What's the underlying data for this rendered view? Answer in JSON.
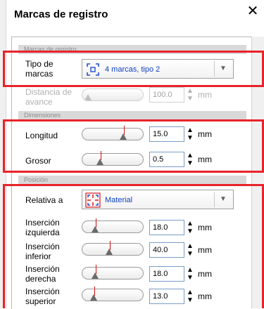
{
  "dialog": {
    "title": "Marcas de registro",
    "close": "✕"
  },
  "sections": {
    "marks_header": "Marcas de registro",
    "dimensions_header": "Dimensiones",
    "position_header": "Posición"
  },
  "marks": {
    "type_label": "Tipo de marcas",
    "type_value": "4 marcas, tipo 2",
    "advance_label": "Distancia de avance",
    "advance_value": "100.0",
    "advance_unit": "mm"
  },
  "dimensions": {
    "length_label": "Longitud",
    "length_value": "15.0",
    "length_unit": "mm",
    "thickness_label": "Grosor",
    "thickness_value": "0.5",
    "thickness_unit": "mm"
  },
  "position": {
    "relative_label": "Relativa a",
    "relative_value": "Material",
    "insets": [
      {
        "label": "Inserción izquierda",
        "value": "18.0",
        "unit": "mm"
      },
      {
        "label": "Inserción inferior",
        "value": "40.0",
        "unit": "mm"
      },
      {
        "label": "Inserción derecha",
        "value": "18.0",
        "unit": "mm"
      },
      {
        "label": "Inserción superior",
        "value": "13.0",
        "unit": "mm"
      }
    ]
  },
  "colors": {
    "highlight": "#e8232a",
    "section_bg": "#d9d9d9",
    "link_text": "#1040c0"
  },
  "icons": {
    "close": "close-icon",
    "marks": "registration-marks-icon",
    "material": "material-position-icon",
    "dropdown": "chevron-down-icon"
  }
}
